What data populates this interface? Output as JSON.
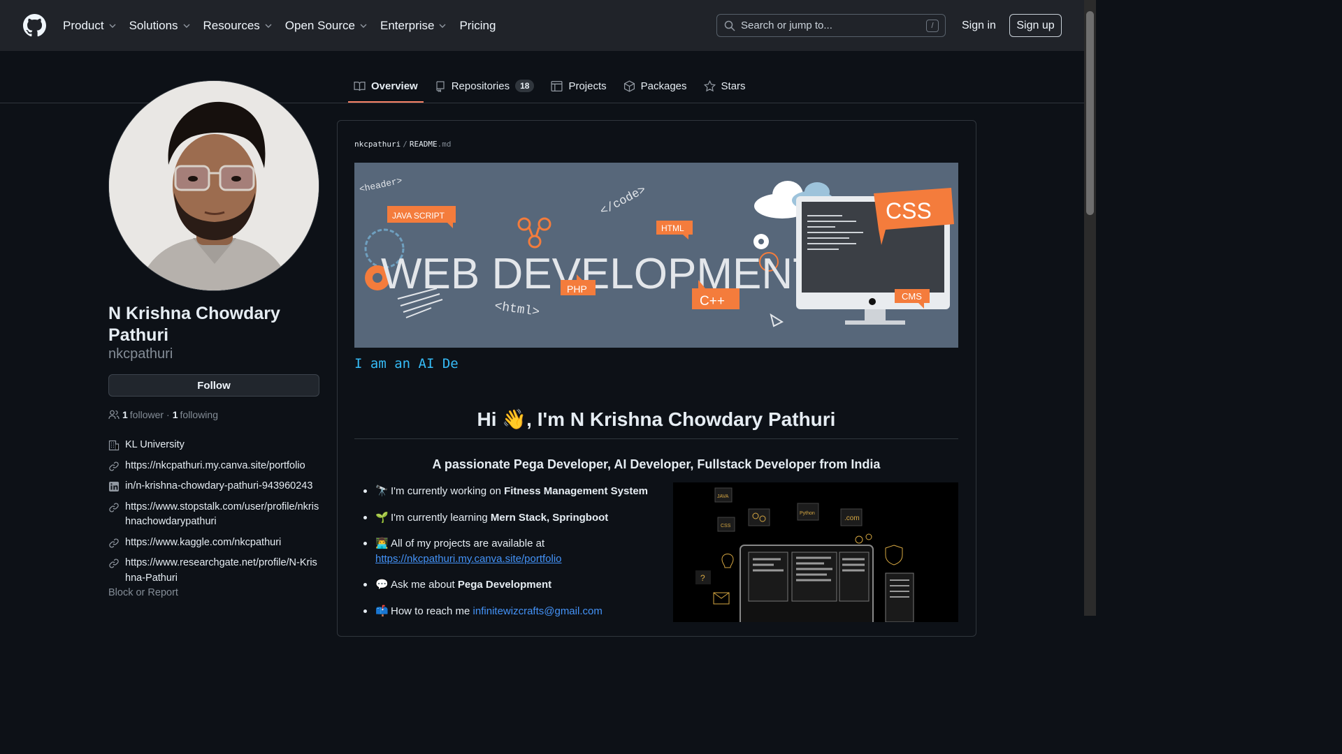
{
  "header": {
    "nav": [
      {
        "label": "Product",
        "has_menu": true
      },
      {
        "label": "Solutions",
        "has_menu": true
      },
      {
        "label": "Resources",
        "has_menu": true
      },
      {
        "label": "Open Source",
        "has_menu": true
      },
      {
        "label": "Enterprise",
        "has_menu": true
      },
      {
        "label": "Pricing",
        "has_menu": false
      }
    ],
    "search_placeholder": "Search or jump to...",
    "search_shortcut": "/",
    "signin": "Sign in",
    "signup": "Sign up"
  },
  "tabs": [
    {
      "label": "Overview",
      "icon": "book-icon",
      "active": true
    },
    {
      "label": "Repositories",
      "icon": "repo-icon",
      "count": "18"
    },
    {
      "label": "Projects",
      "icon": "table-icon"
    },
    {
      "label": "Packages",
      "icon": "package-icon"
    },
    {
      "label": "Stars",
      "icon": "star-icon"
    }
  ],
  "profile": {
    "full_name": "N Krishna Chowdary Pathuri",
    "username": "nkcpathuri",
    "follow_label": "Follow",
    "followers_count": "1",
    "followers_label": "follower",
    "dot": "·",
    "following_count": "1",
    "following_label": "following",
    "meta": [
      {
        "icon": "organization-icon",
        "text": "KL University"
      },
      {
        "icon": "link-icon",
        "text": "https://nkcpathuri.my.canva.site/portfolio"
      },
      {
        "icon": "linkedin-icon",
        "text": "in/n-krishna-chowdary-pathuri-943960243"
      },
      {
        "icon": "link-icon",
        "text": "https://www.stopstalk.com/user/profile/nkrishnachowdarypathuri"
      },
      {
        "icon": "link-icon",
        "text": "https://www.kaggle.com/nkcpathuri"
      },
      {
        "icon": "link-icon",
        "text": "https://www.researchgate.net/profile/N-Krishna-Pathuri"
      }
    ],
    "block_report": "Block or Report"
  },
  "readme": {
    "owner": "nkcpathuri",
    "separator": "/",
    "file_name": "README",
    "file_ext": ".md",
    "banner": {
      "title": "WEB DEVELOPMENT",
      "tags": [
        "<header>",
        "JAVA SCRIPT",
        "</code>",
        "HTML",
        "CSS",
        "PHP",
        "<html>",
        "C++",
        "CMS"
      ]
    },
    "typing_text": "I am an AI De",
    "hi_prefix": "Hi ",
    "hi_emoji": "👋",
    "hi_suffix": ", I'm N Krishna Chowdary Pathuri",
    "subtitle": "A passionate Pega Developer, AI Developer, Fullstack Developer from India",
    "bullets": [
      {
        "emoji": "🔭",
        "text": "I'm currently working on ",
        "bold": "Fitness Management System"
      },
      {
        "emoji": "🌱",
        "text": "I'm currently learning ",
        "bold": "Mern Stack, Springboot"
      },
      {
        "emoji": "👨‍💻",
        "text": "All of my projects are available at ",
        "link": "https://nkcpathuri.my.canva.site/portfolio"
      },
      {
        "emoji": "💬",
        "text": "Ask me about ",
        "bold": "Pega Development"
      },
      {
        "emoji": "📫",
        "text": "How to reach me ",
        "email": "infinitewizcrafts@gmail.com"
      }
    ],
    "illustration_labels": [
      "JAVA",
      "CSS",
      "Python",
      ".com",
      "?"
    ]
  },
  "colors": {
    "accent_tab": "#f78166",
    "link": "#4493f8",
    "typing": "#36bcf7",
    "banner_bg": "#57677a",
    "orange": "#f47c3c"
  }
}
